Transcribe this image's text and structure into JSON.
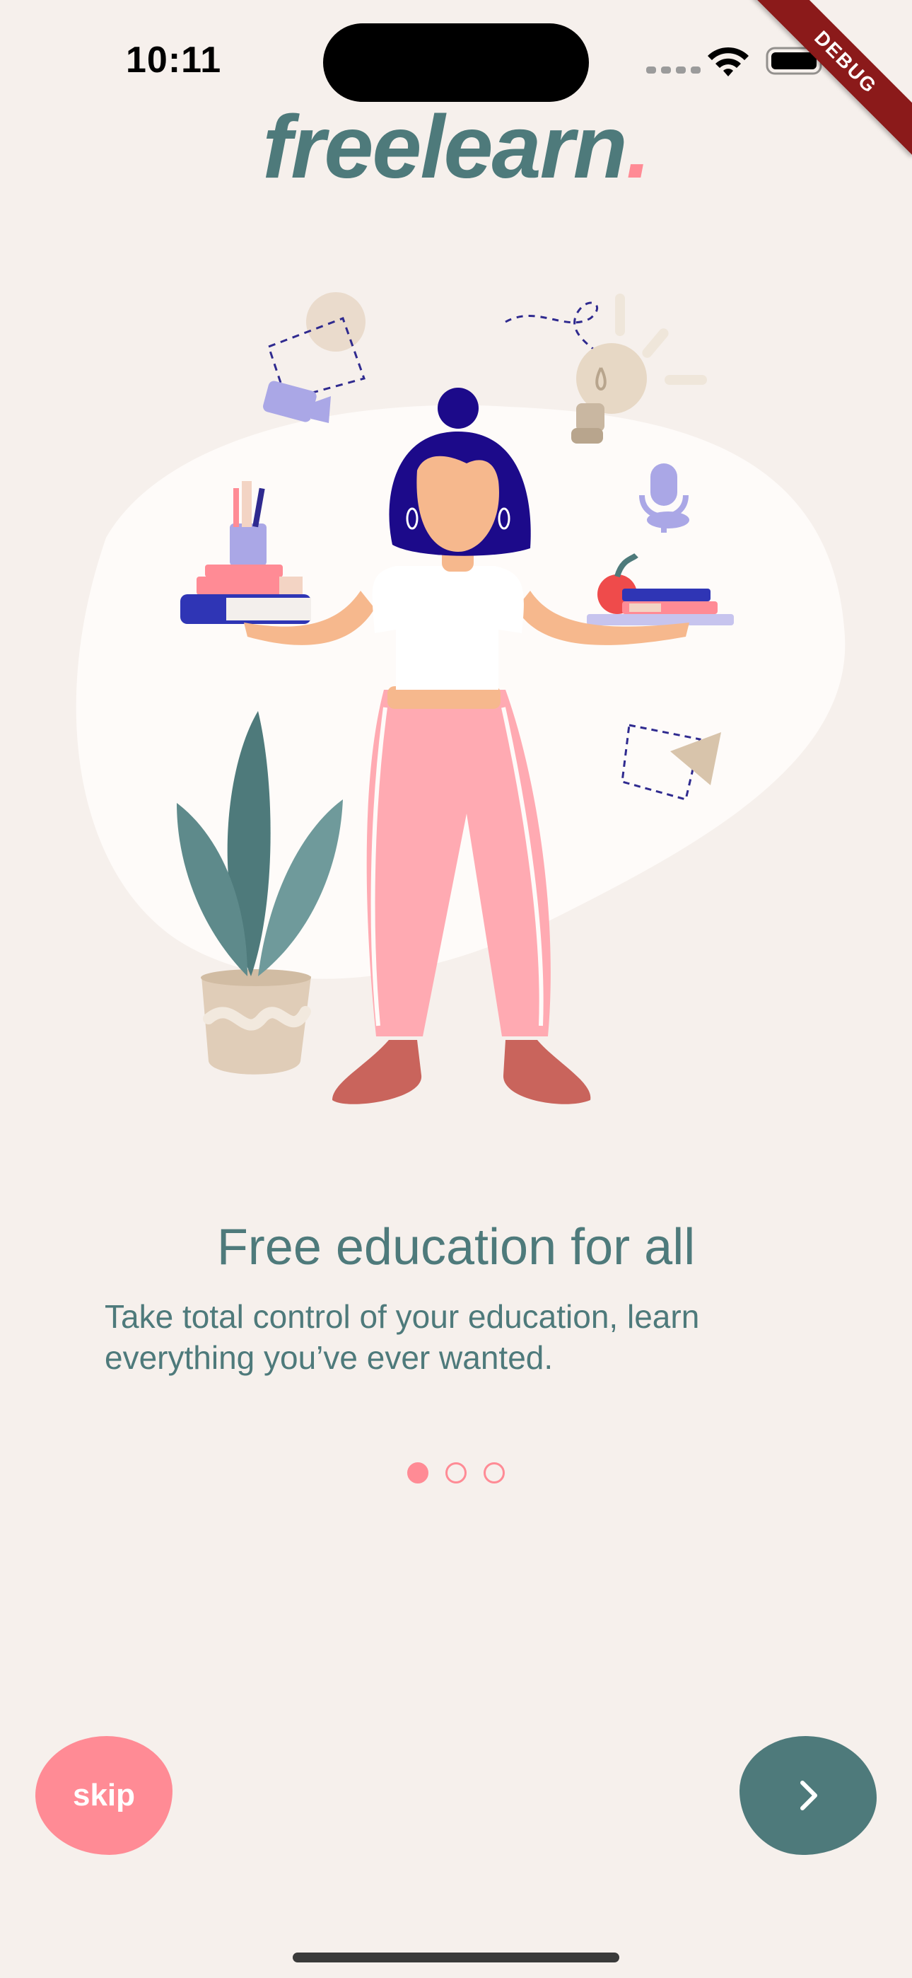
{
  "status_bar": {
    "time": "10:11",
    "wifi_icon": "wifi-icon",
    "battery_icon": "battery-icon"
  },
  "debug_banner": "DEBUG",
  "logo": {
    "text": "freelearn",
    "dot": "."
  },
  "onboarding": {
    "title": "Free education for all",
    "description": "Take total control of your education, learn everything you’ve ever wanted.",
    "page_count": 3,
    "active_page": 1
  },
  "buttons": {
    "skip_label": "skip",
    "next_icon": "chevron-right-icon"
  },
  "colors": {
    "background": "#f6f0ec",
    "primary_teal": "#4e7a7b",
    "accent_pink": "#ff8b95",
    "debug_red": "#8b1a1a"
  }
}
